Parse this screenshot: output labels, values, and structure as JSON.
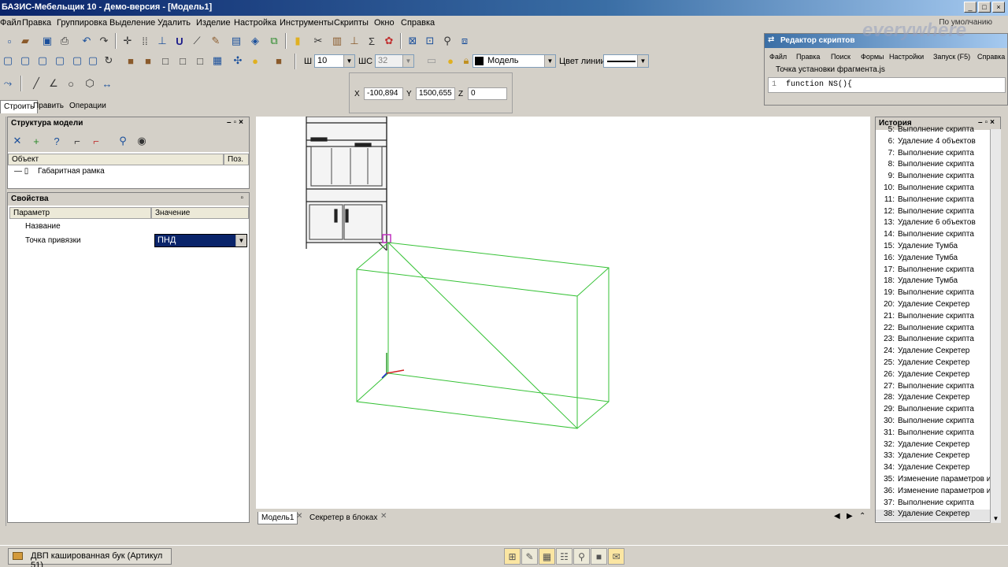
{
  "window": {
    "title": "БАЗИС-Мебельщик 10 - Демо-версия - [Модель1]"
  },
  "menu": [
    "Файл",
    "Правка",
    "Группировка",
    "Выделение",
    "Удалить",
    "Изделие",
    "Настройка",
    "Инструменты",
    "Скрипты",
    "Окно",
    "Справка"
  ],
  "profile": "По умолчанию",
  "toolbar": {
    "width_label": "Ш",
    "width_value": "10",
    "height_label": "ШС",
    "height_value": "32",
    "layer_value": "Модель",
    "line_color_label": "Цвет линии"
  },
  "coords": {
    "x_label": "X",
    "x": "-100,894",
    "y_label": "Y",
    "y": "1500,655",
    "z_label": "Z",
    "z": "0"
  },
  "tabs": [
    "Строить",
    "Править",
    "Операции"
  ],
  "structure": {
    "title": "Структура модели",
    "col_object": "Объект",
    "col_pos": "Поз.",
    "items": [
      "Габаритная рамка"
    ]
  },
  "properties": {
    "title": "Свойства",
    "col_param": "Параметр",
    "col_value": "Значение",
    "rows": [
      {
        "param": "Название",
        "value": ""
      },
      {
        "param": "Точка привязки",
        "value": "ПНД"
      }
    ]
  },
  "script_editor": {
    "title": "Редактор скриптов",
    "menu": [
      "Файл",
      "Правка",
      "Поиск",
      "Формы",
      "Настройки",
      "Запуск (F5)",
      "Справка"
    ],
    "file": "Точка установки фрагмента.js",
    "line_no": "1",
    "code": "function NS(){"
  },
  "watermark": "everywhere",
  "history": {
    "title": "История",
    "items": [
      {
        "n": "5:",
        "text": "Выполнение скрипта"
      },
      {
        "n": "6:",
        "text": "Удаление 4 объектов"
      },
      {
        "n": "7:",
        "text": "Выполнение скрипта"
      },
      {
        "n": "8:",
        "text": "Выполнение скрипта"
      },
      {
        "n": "9:",
        "text": "Выполнение скрипта"
      },
      {
        "n": "10:",
        "text": "Выполнение скрипта"
      },
      {
        "n": "11:",
        "text": "Выполнение скрипта"
      },
      {
        "n": "12:",
        "text": "Выполнение скрипта"
      },
      {
        "n": "13:",
        "text": "Удаление 6 объектов"
      },
      {
        "n": "14:",
        "text": "Выполнение скрипта"
      },
      {
        "n": "15:",
        "text": "Удаление Тумба"
      },
      {
        "n": "16:",
        "text": "Удаление Тумба"
      },
      {
        "n": "17:",
        "text": "Выполнение скрипта"
      },
      {
        "n": "18:",
        "text": "Удаление Тумба"
      },
      {
        "n": "19:",
        "text": "Выполнение скрипта"
      },
      {
        "n": "20:",
        "text": "Удаление Секретер"
      },
      {
        "n": "21:",
        "text": "Выполнение скрипта"
      },
      {
        "n": "22:",
        "text": "Выполнение скрипта"
      },
      {
        "n": "23:",
        "text": "Выполнение скрипта"
      },
      {
        "n": "24:",
        "text": "Удаление Секретер"
      },
      {
        "n": "25:",
        "text": "Удаление Секретер"
      },
      {
        "n": "26:",
        "text": "Удаление Секретер"
      },
      {
        "n": "27:",
        "text": "Выполнение скрипта"
      },
      {
        "n": "28:",
        "text": "Удаление Секретер"
      },
      {
        "n": "29:",
        "text": "Выполнение скрипта"
      },
      {
        "n": "30:",
        "text": "Выполнение скрипта"
      },
      {
        "n": "31:",
        "text": "Выполнение скрипта"
      },
      {
        "n": "32:",
        "text": "Удаление Секретер"
      },
      {
        "n": "33:",
        "text": "Удаление Секретер"
      },
      {
        "n": "34:",
        "text": "Удаление Секретер"
      },
      {
        "n": "35:",
        "text": "Изменение параметров изде"
      },
      {
        "n": "36:",
        "text": "Изменение параметров изде"
      },
      {
        "n": "37:",
        "text": "Выполнение скрипта"
      },
      {
        "n": "38:",
        "text": "Удаление Секретер"
      }
    ]
  },
  "doc_tabs": [
    "Модель1",
    "Секретер в блоках"
  ],
  "status": {
    "material": "ДВП кашированная бук (Артикул 51)"
  }
}
